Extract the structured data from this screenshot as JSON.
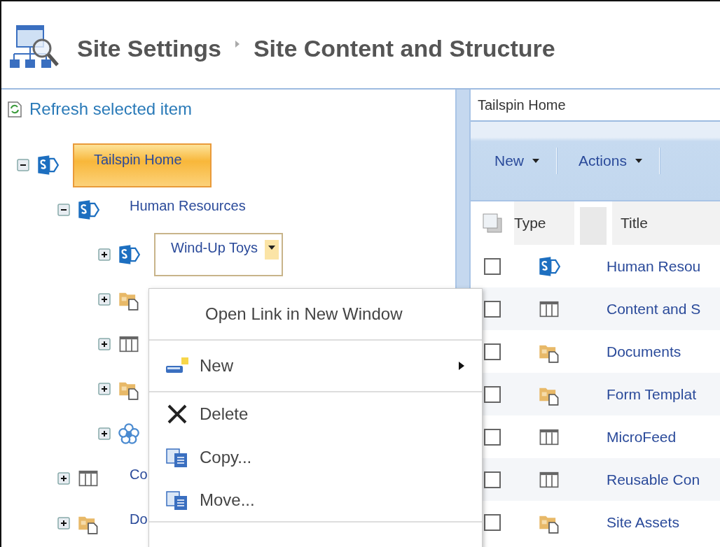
{
  "header": {
    "breadcrumb": [
      "Site Settings",
      "Site Content and Structure"
    ]
  },
  "tree_panel": {
    "refresh_link": "Refresh selected item",
    "tree": [
      {
        "kind": "site",
        "label": "Tailspin Home",
        "expanded": true,
        "selected": true,
        "menu_open": false,
        "children": [
          {
            "kind": "site",
            "label": "Human Resources",
            "expanded": true,
            "selected": false,
            "menu_open": false,
            "children": [
              {
                "kind": "site",
                "label": "Wind-Up Toys",
                "expanded": false,
                "selected": false,
                "menu_open": true
              },
              {
                "kind": "library",
                "expanded": false
              },
              {
                "kind": "list",
                "expanded": false
              },
              {
                "kind": "library",
                "expanded": false
              },
              {
                "kind": "workflow",
                "expanded": false
              }
            ]
          },
          {
            "kind": "list",
            "label": "Co",
            "expanded": false,
            "selected": false,
            "menu_open": false
          },
          {
            "kind": "library",
            "label": "Do",
            "expanded": false,
            "selected": false,
            "menu_open": false
          }
        ]
      }
    ]
  },
  "context_menu": {
    "items": [
      {
        "kind": "plain",
        "label": "Open Link in New Window",
        "separator_after": true
      },
      {
        "kind": "new",
        "label": "New",
        "submenu": true,
        "separator_after": true
      },
      {
        "kind": "delete",
        "label": "Delete",
        "separator_after": false
      },
      {
        "kind": "copy",
        "label": "Copy...",
        "separator_after": false
      },
      {
        "kind": "move",
        "label": "Move...",
        "separator_after": true
      }
    ]
  },
  "content_panel": {
    "location": "Tailspin Home",
    "toolbar": [
      {
        "label": "New"
      },
      {
        "label": "Actions"
      }
    ],
    "columns": [
      "Type",
      "Title"
    ],
    "rows": [
      {
        "kind": "site",
        "title": "Human Resou",
        "checked": false
      },
      {
        "kind": "list",
        "title": "Content and S",
        "checked": false
      },
      {
        "kind": "library",
        "title": "Documents",
        "checked": false
      },
      {
        "kind": "library",
        "title": "Form Templat",
        "checked": false
      },
      {
        "kind": "list",
        "title": "MicroFeed",
        "checked": false
      },
      {
        "kind": "list",
        "title": "Reusable Con",
        "checked": false
      },
      {
        "kind": "library",
        "title": "Site Assets",
        "checked": false
      }
    ]
  }
}
